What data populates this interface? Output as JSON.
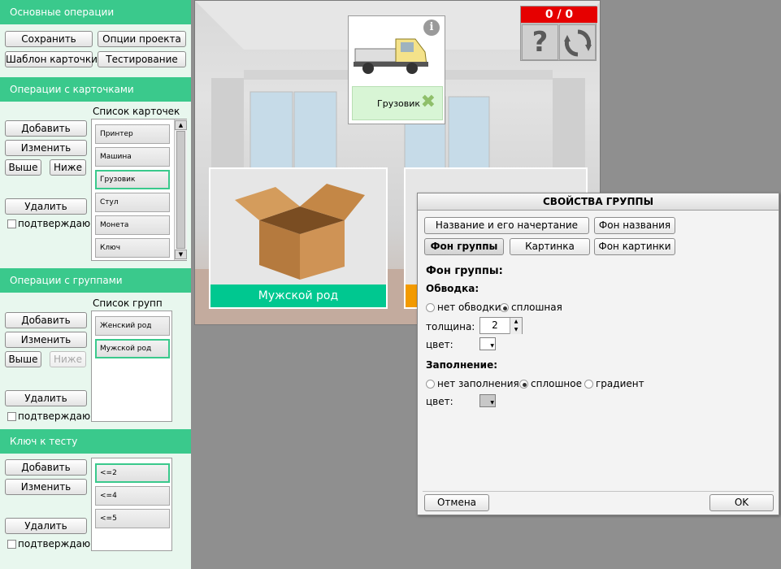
{
  "left": {
    "basic": {
      "header": "Основные операции",
      "save": "Сохранить",
      "project_options": "Опции проекта",
      "card_template": "Шаблон карточки",
      "testing": "Тестирование"
    },
    "cards": {
      "header": "Операции с карточками",
      "list_title": "Список карточек",
      "add": "Добавить",
      "edit": "Изменить",
      "up": "Выше",
      "down": "Ниже",
      "delete": "Удалить",
      "confirm": "подтверждаю",
      "items": [
        "Принтер",
        "Машина",
        "Грузовик",
        "Стул",
        "Монета",
        "Ключ"
      ],
      "selected_index": 2
    },
    "groups": {
      "header": "Операции с группами",
      "list_title": "Список групп",
      "add": "Добавить",
      "edit": "Изменить",
      "up": "Выше",
      "down": "Ниже",
      "delete": "Удалить",
      "confirm": "подтверждаю",
      "items": [
        "Женский род",
        "Мужской род"
      ],
      "selected_index": 1
    },
    "key": {
      "header": "Ключ к тесту",
      "add": "Добавить",
      "edit": "Изменить",
      "delete": "Удалить",
      "confirm": "подтверждаю",
      "items": [
        "<=2",
        "<=4",
        "<=5"
      ],
      "selected_index": 0
    }
  },
  "stage": {
    "score": "0 / 0",
    "help_icon": "question-icon",
    "reset_icon": "refresh-icon",
    "card_label": "Грузовик",
    "groups": [
      {
        "label": "Мужской род",
        "color": "#00c890"
      },
      {
        "label": "",
        "color": "#f39a00"
      }
    ]
  },
  "dialog": {
    "title": "СВОЙСТВА ГРУППЫ",
    "tabs": [
      "Название и его начертание",
      "Фон названия",
      "Фон группы",
      "Картинка",
      "Фон картинки"
    ],
    "active_tab": 2,
    "section_title": "Фон группы:",
    "stroke": {
      "title": "Обводка:",
      "none": "нет обводки",
      "solid": "сплошная",
      "thickness_label": "толщина:",
      "thickness_value": "2",
      "color_label": "цвет:",
      "color": "#ffffff"
    },
    "fill": {
      "title": "Заполнение:",
      "none": "нет заполнения",
      "solid": "сплошное",
      "gradient": "градиент",
      "color_label": "цвет:",
      "color": "#c8c8c8"
    },
    "cancel": "Отмена",
    "ok": "OK"
  }
}
